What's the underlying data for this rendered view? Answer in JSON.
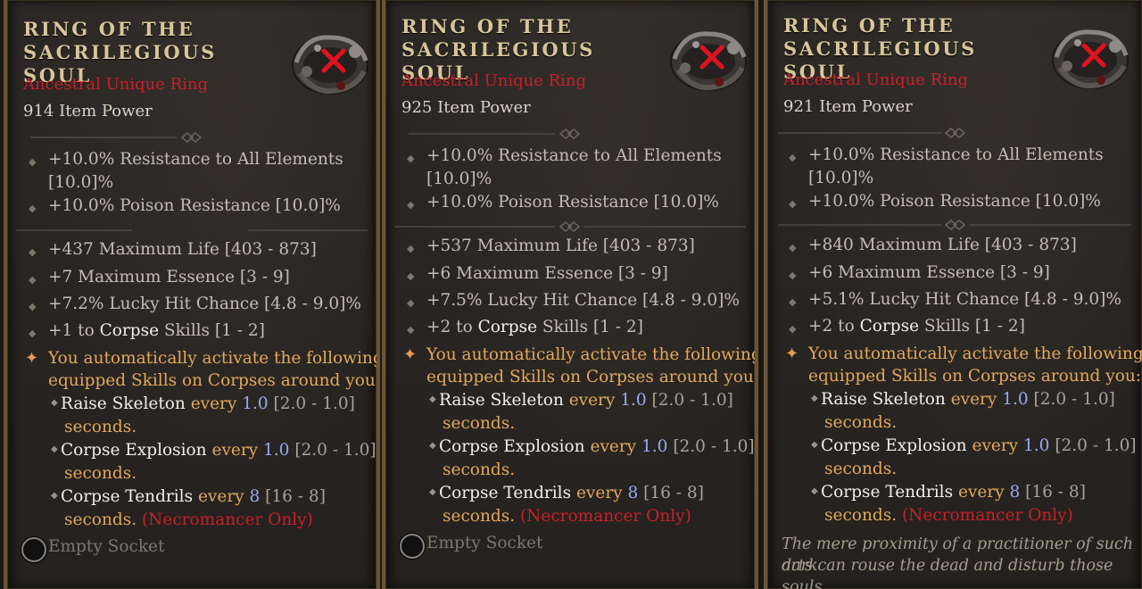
{
  "cards": [
    {
      "title_line1": "Ring of the",
      "title_line2": "Sacrilegious Soul",
      "rarity": "Ancestral Unique Ring",
      "item_power": "914 Item Power",
      "implicits": [
        {
          "line1": "+10.0% Resistance to All Elements",
          "line2": "[10.0]%"
        },
        {
          "line1": "+10.0% Poison Resistance [10.0]%"
        }
      ],
      "affixes": [
        "+437 Maximum Life [403 - 873]",
        "+7 Maximum Essence [3 - 9]",
        "+7.2% Lucky Hit Chance [4.8 - 9.0]%"
      ],
      "skill_affix": {
        "prefix": "+1 to ",
        "skill": "Corpse",
        "suffix": " Skills [1 - 2]"
      },
      "unique_power": {
        "line1": "You automatically activate the following",
        "line2": "equipped Skills on Corpses around you:"
      },
      "sub_skills": [
        {
          "name": "Raise Skeleton",
          "every": " every ",
          "value": "1.0",
          "range": " [2.0 - 1.0]",
          "unit": "seconds."
        },
        {
          "name": "Corpse Explosion",
          "every": " every ",
          "value": "1.0",
          "range": " [2.0 - 1.0]",
          "unit": "seconds."
        },
        {
          "name": "Corpse Tendrils",
          "every": " every ",
          "value": "8",
          "range": " [16 - 8]",
          "unit": "seconds.",
          "class_note": "(Necromancer Only)"
        }
      ],
      "socket": "Empty Socket"
    },
    {
      "title_line1": "Ring of the",
      "title_line2": "Sacrilegious Soul",
      "rarity": "Ancestral Unique Ring",
      "item_power": "925 Item Power",
      "implicits": [
        {
          "line1": "+10.0% Resistance to All Elements",
          "line2": "[10.0]%"
        },
        {
          "line1": "+10.0% Poison Resistance [10.0]%"
        }
      ],
      "affixes": [
        "+537 Maximum Life [403 - 873]",
        "+6 Maximum Essence [3 - 9]",
        "+7.5% Lucky Hit Chance [4.8 - 9.0]%"
      ],
      "skill_affix": {
        "prefix": "+2 to ",
        "skill": "Corpse",
        "suffix": " Skills [1 - 2]"
      },
      "unique_power": {
        "line1": "You automatically activate the following",
        "line2": "equipped Skills on Corpses around you:"
      },
      "sub_skills": [
        {
          "name": "Raise Skeleton",
          "every": " every ",
          "value": "1.0",
          "range": " [2.0 - 1.0]",
          "unit": "seconds."
        },
        {
          "name": "Corpse Explosion",
          "every": " every ",
          "value": "1.0",
          "range": " [2.0 - 1.0]",
          "unit": "seconds."
        },
        {
          "name": "Corpse Tendrils",
          "every": " every ",
          "value": "8",
          "range": " [16 - 8]",
          "unit": "seconds.",
          "class_note": "(Necromancer Only)"
        }
      ],
      "socket": "Empty Socket"
    },
    {
      "title_line1": "Ring of the",
      "title_line2": "Sacrilegious Soul",
      "rarity": "Ancestral Unique Ring",
      "item_power": "921 Item Power",
      "implicits": [
        {
          "line1": "+10.0% Resistance to All Elements",
          "line2": "[10.0]%"
        },
        {
          "line1": "+10.0% Poison Resistance [10.0]%"
        }
      ],
      "affixes": [
        "+840 Maximum Life [403 - 873]",
        "+6 Maximum Essence [3 - 9]",
        "+5.1% Lucky Hit Chance [4.8 - 9.0]%"
      ],
      "skill_affix": {
        "prefix": "+2 to ",
        "skill": "Corpse",
        "suffix": " Skills [1 - 2]"
      },
      "unique_power": {
        "line1": "You automatically activate the following",
        "line2": "equipped Skills on Corpses around you:"
      },
      "sub_skills": [
        {
          "name": "Raise Skeleton",
          "every": " every ",
          "value": "1.0",
          "range": " [2.0 - 1.0]",
          "unit": "seconds."
        },
        {
          "name": "Corpse Explosion",
          "every": " every ",
          "value": "1.0",
          "range": " [2.0 - 1.0]",
          "unit": "seconds."
        },
        {
          "name": "Corpse Tendrils",
          "every": " every ",
          "value": "8",
          "range": " [16 - 8]",
          "unit": "seconds.",
          "class_note": "(Necromancer Only)"
        }
      ],
      "flavor": {
        "line1": "The mere proximity of a practitioner of such dark",
        "line2": "arts can rouse the dead and disturb those souls"
      }
    }
  ],
  "colors": {
    "title": "#d8c69a",
    "unique_red": "#c8202a",
    "unique_power_gold": "#e2a85c",
    "value_blue": "#9aa8f2",
    "frame": "#6b5534"
  },
  "icons": {
    "item": "ring-icon",
    "compare": "red-x-icon",
    "socket": "socket-icon",
    "implicit_bullet": "diamond-bullet-icon",
    "unique_bullet": "star-bullet-icon"
  }
}
